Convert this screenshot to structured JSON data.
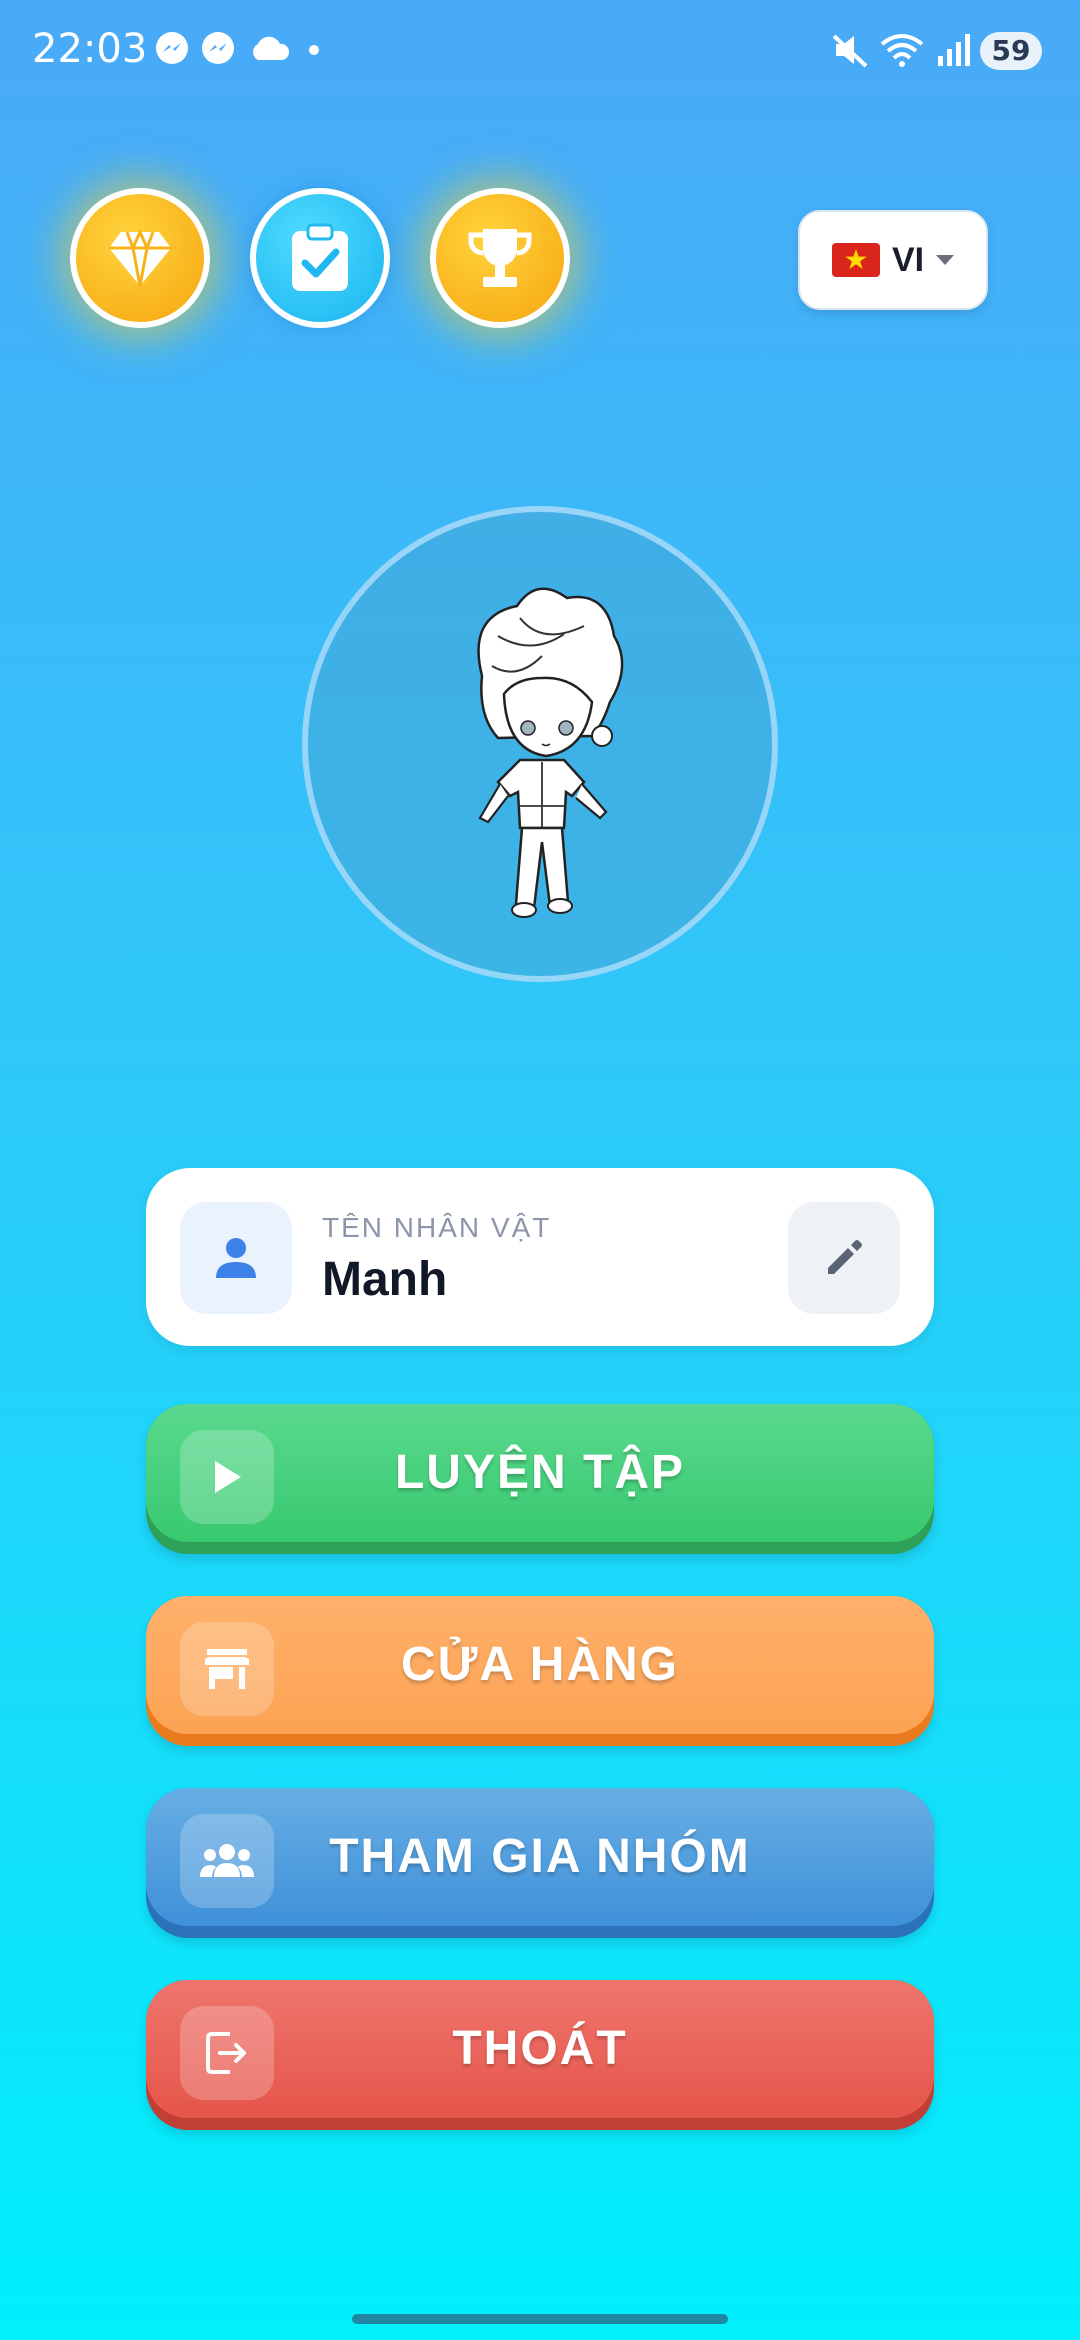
{
  "status_bar": {
    "time": "22:03",
    "icons": [
      "messenger-icon",
      "messenger-icon",
      "cloud-icon",
      "dot-icon",
      "mute-icon",
      "wifi-icon",
      "signal-icon"
    ],
    "battery": "59"
  },
  "quick_actions": [
    {
      "icon": "diamond-icon"
    },
    {
      "icon": "clipboard-check-icon"
    },
    {
      "icon": "trophy-icon"
    }
  ],
  "language": {
    "code": "VI",
    "flag": "vietnam-flag"
  },
  "profile": {
    "label": "TÊN NHÂN VẬT",
    "name": "Manh"
  },
  "menu": {
    "practice": "LUYỆN TẬP",
    "shop": "CỬA HÀNG",
    "join_group": "THAM GIA NHÓM",
    "exit": "THOÁT"
  },
  "colors": {
    "practice": "#3fcd75",
    "shop": "#fda75a",
    "join_group": "#4a9ade",
    "exit": "#e85b50",
    "gold": "#f8b41a",
    "accent_blue": "#1fb8f0"
  }
}
